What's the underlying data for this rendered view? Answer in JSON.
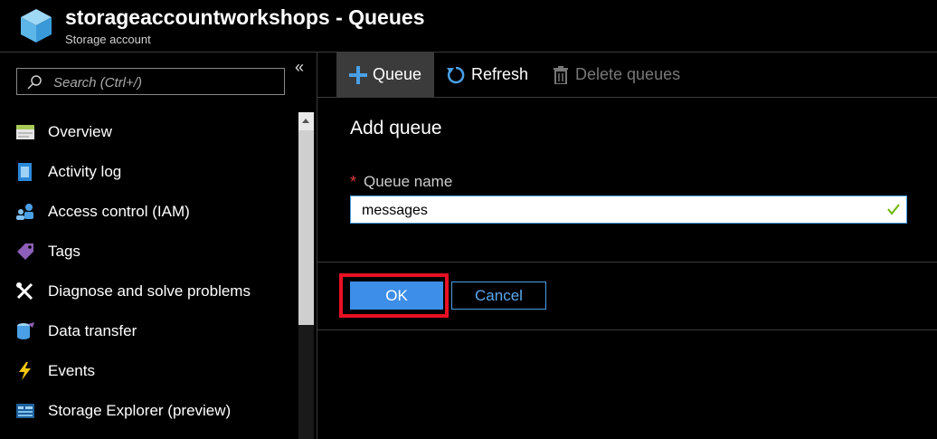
{
  "header": {
    "title": "storageaccountworkshops - Queues",
    "subtitle": "Storage account",
    "logo_icon": "storage-cube-icon"
  },
  "sidebar": {
    "collapse_label": "«",
    "search": {
      "placeholder": "Search (Ctrl+/)",
      "value": ""
    },
    "items": [
      {
        "label": "Overview",
        "icon": "overview-icon"
      },
      {
        "label": "Activity log",
        "icon": "activity-log-icon"
      },
      {
        "label": "Access control (IAM)",
        "icon": "iam-icon"
      },
      {
        "label": "Tags",
        "icon": "tag-icon"
      },
      {
        "label": "Diagnose and solve problems",
        "icon": "wrench-icon"
      },
      {
        "label": "Data transfer",
        "icon": "data-transfer-icon"
      },
      {
        "label": "Events",
        "icon": "lightning-icon"
      },
      {
        "label": "Storage Explorer (preview)",
        "icon": "storage-explorer-icon"
      }
    ]
  },
  "toolbar": {
    "queue_label": "Queue",
    "refresh_label": "Refresh",
    "delete_label": "Delete queues"
  },
  "panel": {
    "title": "Add queue",
    "required_mark": "*",
    "field_label": "Queue name",
    "field_value": "messages",
    "ok_label": "OK",
    "cancel_label": "Cancel"
  },
  "colors": {
    "accent": "#3d8ee8",
    "highlight": "#e81123",
    "valid": "#6bb700"
  }
}
